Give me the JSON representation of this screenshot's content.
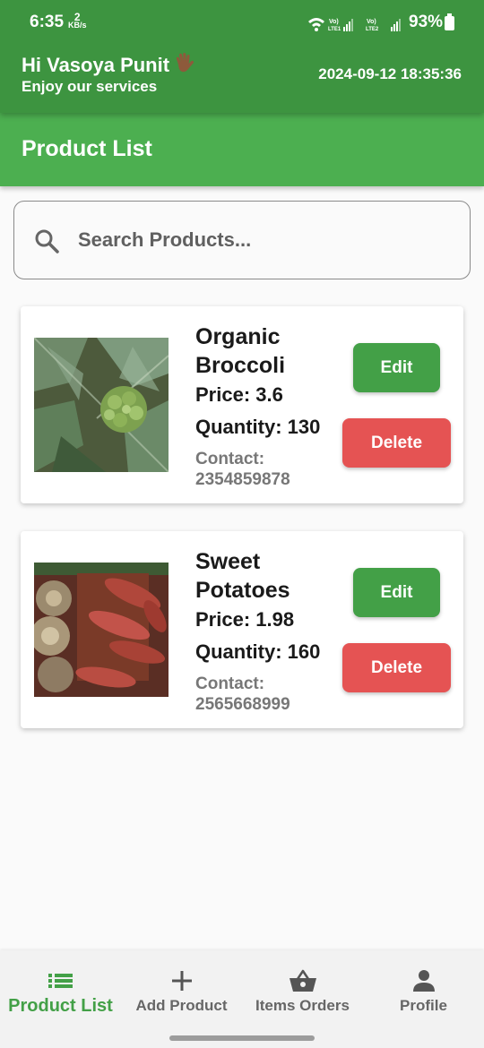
{
  "status_bar": {
    "time": "6:35",
    "speed_value": "2",
    "speed_unit": "KB/s",
    "sim1": "Vo) LTE1",
    "sim2": "Vo) LTE2",
    "battery": "93%"
  },
  "header": {
    "greeting": "Hi Vasoya Punit",
    "subtitle": "Enjoy our services",
    "datetime": "2024-09-12 18:35:36",
    "background": "#3d9440"
  },
  "app_bar": {
    "title": "Product List",
    "background": "#4caf50"
  },
  "search": {
    "placeholder": "Search Products...",
    "icon": "search-icon"
  },
  "products": [
    {
      "name": "Organic Broccoli",
      "price": "Price: 3.6",
      "quantity": "Quantity: 130",
      "contact_label": "Contact:",
      "contact_number": "2354859878",
      "edit_label": "Edit",
      "delete_label": "Delete"
    },
    {
      "name": "Sweet Potatoes",
      "price": "Price: 1.98",
      "quantity": "Quantity: 160",
      "contact_label": "Contact:",
      "contact_number": "2565668999",
      "edit_label": "Edit",
      "delete_label": "Delete"
    }
  ],
  "colors": {
    "edit": "#43a047",
    "delete": "#e55353",
    "nav_active": "#43a047"
  },
  "bottom_nav": {
    "items": [
      {
        "label": "Product List",
        "icon": "list-icon",
        "active": true
      },
      {
        "label": "Add Product",
        "icon": "plus-icon",
        "active": false
      },
      {
        "label": "Items Orders",
        "icon": "basket-icon",
        "active": false
      },
      {
        "label": "Profile",
        "icon": "person-icon",
        "active": false
      }
    ]
  }
}
